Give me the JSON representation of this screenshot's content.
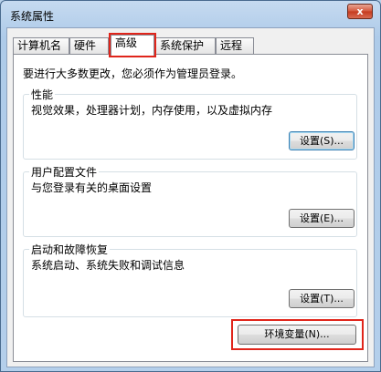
{
  "window": {
    "title": "系统属性",
    "close_label": "x"
  },
  "tabs": [
    {
      "label": "计算机名"
    },
    {
      "label": "硬件"
    },
    {
      "label": "高级"
    },
    {
      "label": "系统保护"
    },
    {
      "label": "远程"
    }
  ],
  "advanced": {
    "intro": "要进行大多数更改，您必须作为管理员登录。",
    "performance": {
      "title": "性能",
      "desc": "视觉效果，处理器计划，内存使用，以及虚拟内存",
      "button": "设置(S)..."
    },
    "profiles": {
      "title": "用户配置文件",
      "desc": "与您登录有关的桌面设置",
      "button": "设置(E)..."
    },
    "startup": {
      "title": "启动和故障恢复",
      "desc": "系统启动、系统失败和调试信息",
      "button": "设置(T)..."
    },
    "env_button": "环境变量(N)..."
  },
  "colors": {
    "highlight": "#e0251b"
  }
}
